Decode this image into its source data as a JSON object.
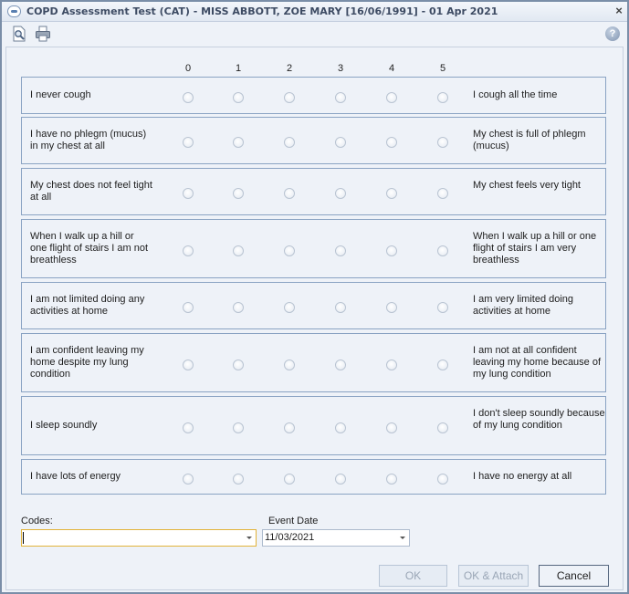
{
  "window": {
    "title": "COPD Assessment Test (CAT) - MISS ABBOTT, ZOE MARY [16/06/1991] - 01 Apr 2021",
    "close_glyph": "×"
  },
  "toolbar": {
    "icons": [
      "print-preview-icon",
      "print-icon"
    ],
    "help_glyph": "?"
  },
  "scale": [
    "0",
    "1",
    "2",
    "3",
    "4",
    "5"
  ],
  "questions": [
    {
      "left": "I never cough",
      "right": "I cough all the time"
    },
    {
      "left": "I have no phlegm (mucus) in my chest at all",
      "right": "My chest is full of phlegm (mucus)"
    },
    {
      "left": "My chest does not feel tight at all",
      "right": "My chest feels very tight"
    },
    {
      "left": "When I walk up a hill or one flight of stairs I am not breathless",
      "right": "When I walk up a hill or one flight of stairs I am very breathless"
    },
    {
      "left": "I am not limited doing any activities at home",
      "right": "I am very limited doing activities at home"
    },
    {
      "left": "I am confident leaving my home despite my lung condition",
      "right": "I am not at all confident leaving my home because of my lung condition"
    },
    {
      "left": "I sleep soundly",
      "right": "I don't sleep soundly because of my lung condition"
    },
    {
      "left": "I have lots of energy",
      "right": "I have no energy at all"
    }
  ],
  "codes": {
    "label": "Codes:",
    "value": ""
  },
  "event_date": {
    "label": "Event Date",
    "value": "11/03/2021"
  },
  "buttons": {
    "ok": "OK",
    "ok_attach": "OK & Attach",
    "cancel": "Cancel"
  }
}
